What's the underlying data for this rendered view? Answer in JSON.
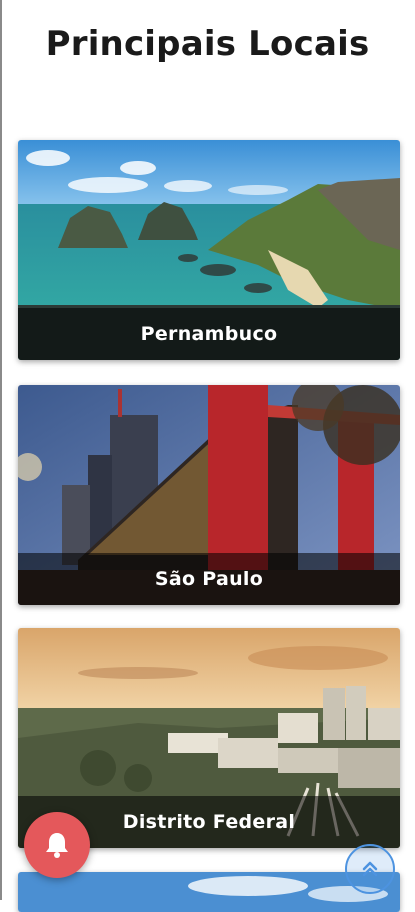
{
  "page": {
    "title": "Principais Locais"
  },
  "locations": [
    {
      "name": "Pernambuco",
      "image": "beach-cliffs-photo"
    },
    {
      "name": "São Paulo",
      "image": "modern-museum-photo"
    },
    {
      "name": "Distrito Federal",
      "image": "city-skyline-photo"
    }
  ],
  "buttons": {
    "notifications_icon": "bell-icon",
    "scroll_top_icon": "chevron-up-icon"
  },
  "colors": {
    "notification_button": "#e4585b",
    "scroll_top_button": "#4d93e0",
    "caption_overlay": "rgba(0,0,0,0.55)"
  }
}
